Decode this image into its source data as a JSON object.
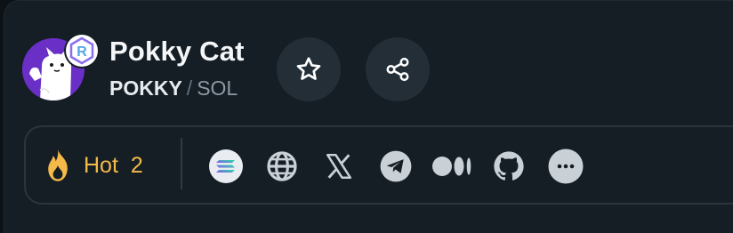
{
  "token": {
    "name": "Pokky Cat",
    "ticker": "POKKY",
    "separator": "/",
    "chain": "SOL",
    "dex_badge_letter": "R"
  },
  "actions": {
    "favorite_icon": "star-icon",
    "share_icon": "share-icon"
  },
  "hot": {
    "label": "Hot",
    "count": "2",
    "icon": "flame-icon"
  },
  "links": [
    {
      "name": "solana-link",
      "icon": "solana-icon"
    },
    {
      "name": "website-link",
      "icon": "globe-icon"
    },
    {
      "name": "x-link",
      "icon": "x-icon"
    },
    {
      "name": "telegram-link",
      "icon": "telegram-icon"
    },
    {
      "name": "medium-link",
      "icon": "medium-icon"
    },
    {
      "name": "github-link",
      "icon": "github-icon"
    },
    {
      "name": "more-links-button",
      "icon": "more-icon"
    }
  ],
  "colors": {
    "background": "#0d1216",
    "panel": "#151e25",
    "button_bg": "#232e37",
    "hot_accent": "#f5b94a",
    "avatar_bg": "#6a2fc6",
    "text_primary": "#f4f6f8",
    "text_muted": "#8d99a3"
  }
}
